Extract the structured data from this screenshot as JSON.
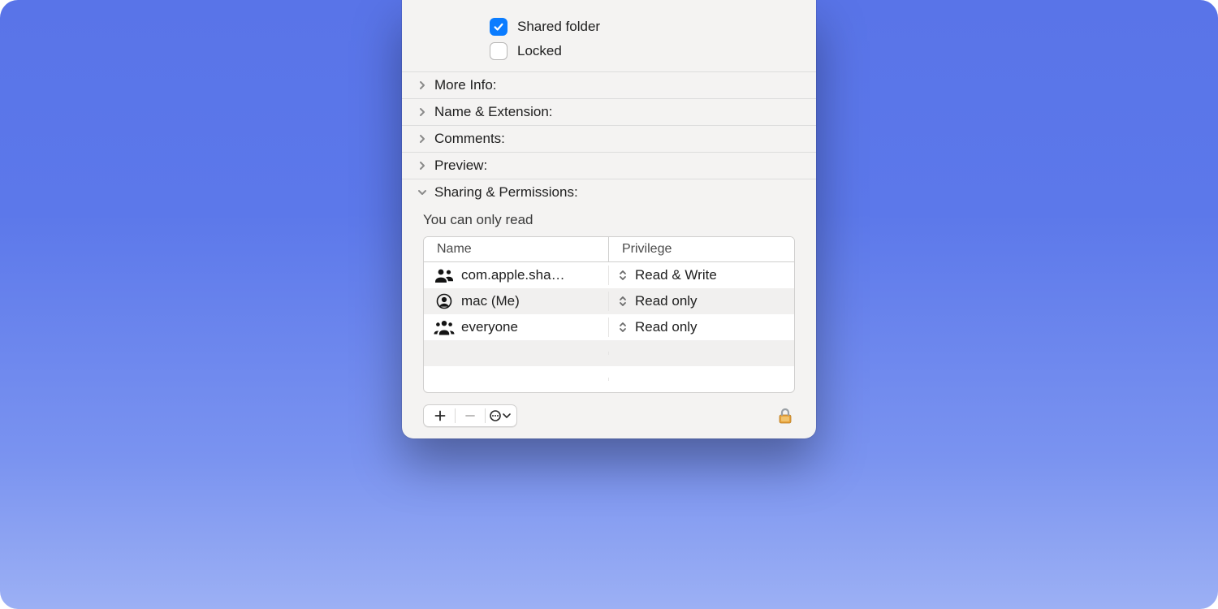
{
  "checkboxes": {
    "shared_label": "Shared folder",
    "shared_checked": true,
    "locked_label": "Locked",
    "locked_checked": false
  },
  "sections": {
    "more_info": "More Info:",
    "name_ext": "Name & Extension:",
    "comments": "Comments:",
    "preview": "Preview:",
    "sharing": "Sharing & Permissions:"
  },
  "sharing": {
    "note": "You can only read",
    "columns": {
      "name": "Name",
      "privilege": "Privilege"
    },
    "rows": [
      {
        "icon": "group",
        "name": "com.apple.sha…",
        "privilege": "Read & Write"
      },
      {
        "icon": "user",
        "name": "mac (Me)",
        "privilege": "Read only"
      },
      {
        "icon": "group3",
        "name": "everyone",
        "privilege": "Read only"
      }
    ]
  },
  "toolbar": {
    "add": "+",
    "remove": "−",
    "more": "…"
  }
}
